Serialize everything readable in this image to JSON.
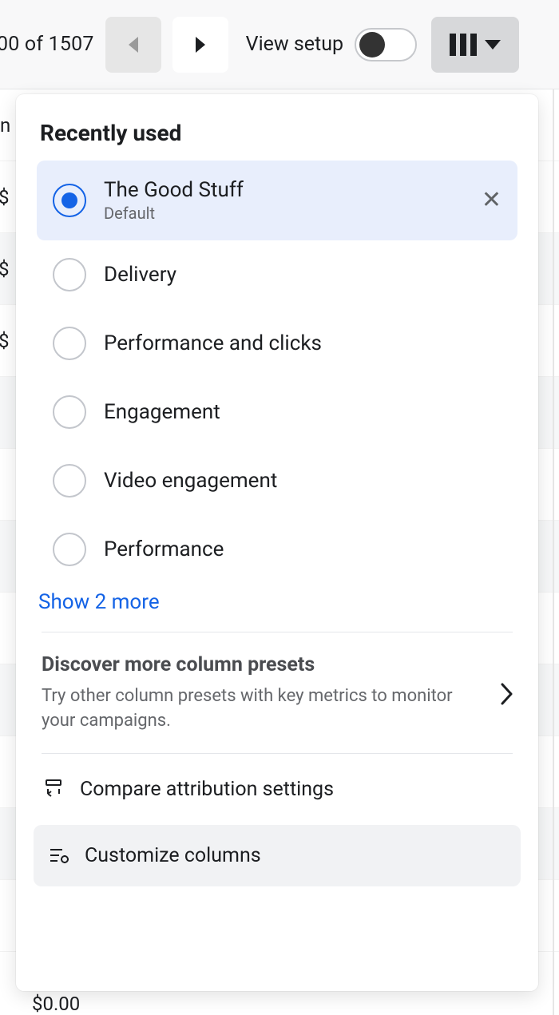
{
  "toolbar": {
    "pager_text": "00 of 1507",
    "view_setup_label": "View setup"
  },
  "bg": {
    "cell_prefix": "$",
    "header_label": "n",
    "bottom_value": "$0.00"
  },
  "panel": {
    "recently_used_title": "Recently used",
    "options": [
      {
        "label": "The Good Stuff",
        "sub": "Default",
        "selected": true
      },
      {
        "label": "Delivery"
      },
      {
        "label": "Performance and clicks"
      },
      {
        "label": "Engagement"
      },
      {
        "label": "Video engagement"
      },
      {
        "label": "Performance"
      }
    ],
    "show_more": "Show 2 more",
    "discover": {
      "title": "Discover more column presets",
      "desc": "Try other column presets with key metrics to monitor your campaigns."
    },
    "actions": {
      "compare": "Compare attribution settings",
      "customize": "Customize columns"
    }
  }
}
